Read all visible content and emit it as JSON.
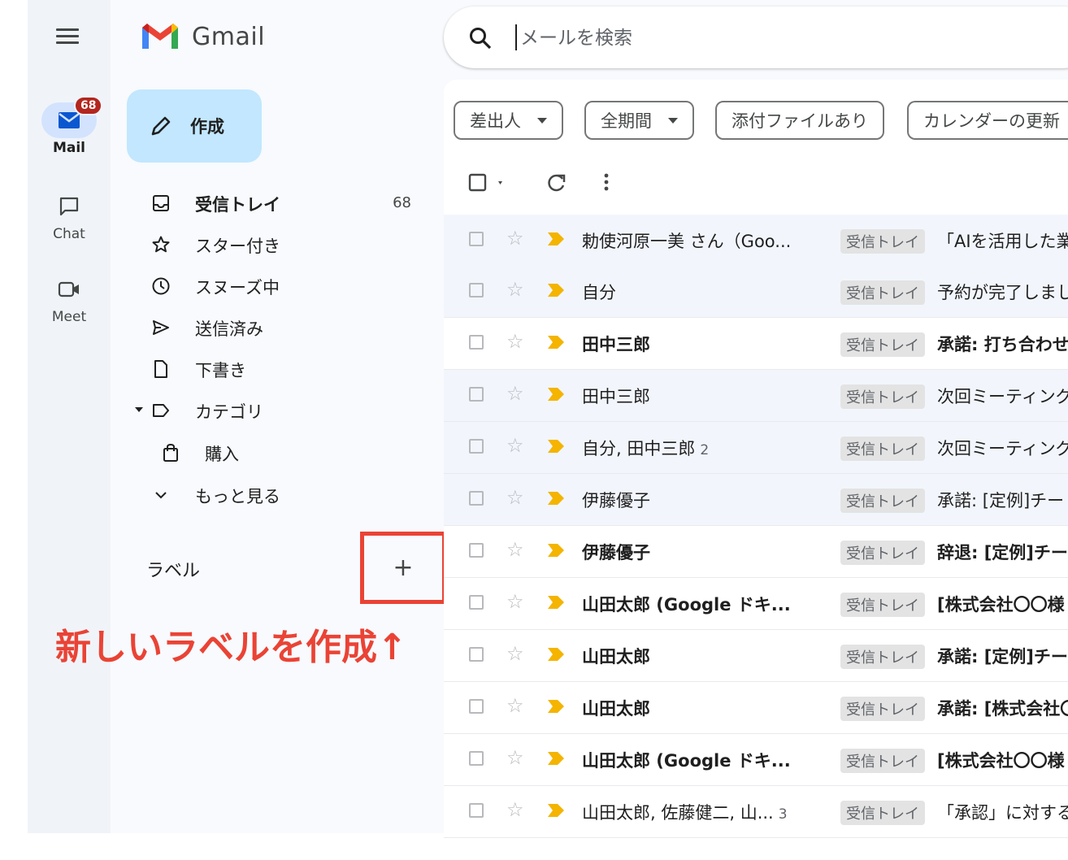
{
  "app": {
    "name": "Gmail"
  },
  "rail": {
    "items": [
      {
        "label": "Mail",
        "badge": "68"
      },
      {
        "label": "Chat"
      },
      {
        "label": "Meet"
      }
    ]
  },
  "compose": {
    "label": "作成"
  },
  "nav": {
    "items": [
      {
        "label": "受信トレイ",
        "count": "68"
      },
      {
        "label": "スター付き"
      },
      {
        "label": "スヌーズ中"
      },
      {
        "label": "送信済み"
      },
      {
        "label": "下書き"
      },
      {
        "label": "カテゴリ"
      },
      {
        "label": "購入"
      },
      {
        "label": "もっと見る"
      }
    ],
    "labels_title": "ラベル",
    "add_label": "+"
  },
  "annotation": {
    "text": "新しいラベルを作成↑"
  },
  "search": {
    "placeholder": "メールを検索"
  },
  "chips": [
    {
      "label": "差出人"
    },
    {
      "label": "全期間"
    },
    {
      "label": "添付ファイルあり"
    },
    {
      "label": "カレンダーの更新"
    }
  ],
  "mail_list": {
    "rows": [
      {
        "sender": "勅使河原一美 さん（Goo...",
        "count": "",
        "label": "受信トレイ",
        "subject": "「AIを活用した業"
      },
      {
        "sender": "自分",
        "count": "",
        "label": "受信トレイ",
        "subject": "予約が完了しまし"
      },
      {
        "sender": "田中三郎",
        "count": "",
        "label": "受信トレイ",
        "subject": "承諾: 打ち合わせ"
      },
      {
        "sender": "田中三郎",
        "count": "",
        "label": "受信トレイ",
        "subject": "次回ミーティング"
      },
      {
        "sender": "自分, 田中三郎",
        "count": "2",
        "label": "受信トレイ",
        "subject": "次回ミーティング"
      },
      {
        "sender": "伊藤優子",
        "count": "",
        "label": "受信トレイ",
        "subject": "承諾: [定例]チー"
      },
      {
        "sender": "伊藤優子",
        "count": "",
        "label": "受信トレイ",
        "subject": "辞退: [定例]チー"
      },
      {
        "sender": "山田太郎 (Google ドキ...",
        "count": "",
        "label": "受信トレイ",
        "subject": "[株式会社〇〇様"
      },
      {
        "sender": "山田太郎",
        "count": "",
        "label": "受信トレイ",
        "subject": "承諾: [定例]チー"
      },
      {
        "sender": "山田太郎",
        "count": "",
        "label": "受信トレイ",
        "subject": "承諾: [株式会社〇"
      },
      {
        "sender": "山田太郎 (Google ドキ...",
        "count": "",
        "label": "受信トレイ",
        "subject": "[株式会社〇〇様"
      },
      {
        "sender": "山田太郎, 佐藤健二, 山...",
        "count": "3",
        "label": "受信トレイ",
        "subject": "「承認」に対する"
      }
    ]
  },
  "colors": {
    "accent": "#0b57d0",
    "compose_bg": "#c2e7ff",
    "annotation": "#ea4335",
    "badge": "#b3261e",
    "important": "#f4b400"
  },
  "icons": [
    "hamburger-icon",
    "gmail-logo-icon",
    "mail-icon",
    "chat-icon",
    "meet-icon",
    "pencil-icon",
    "inbox-icon",
    "star-icon",
    "clock-icon",
    "send-icon",
    "draft-icon",
    "label-icon",
    "shopping-bag-icon",
    "chevron-down-icon",
    "search-icon",
    "checkbox-icon",
    "refresh-icon",
    "more-vert-icon",
    "important-marker-icon"
  ]
}
